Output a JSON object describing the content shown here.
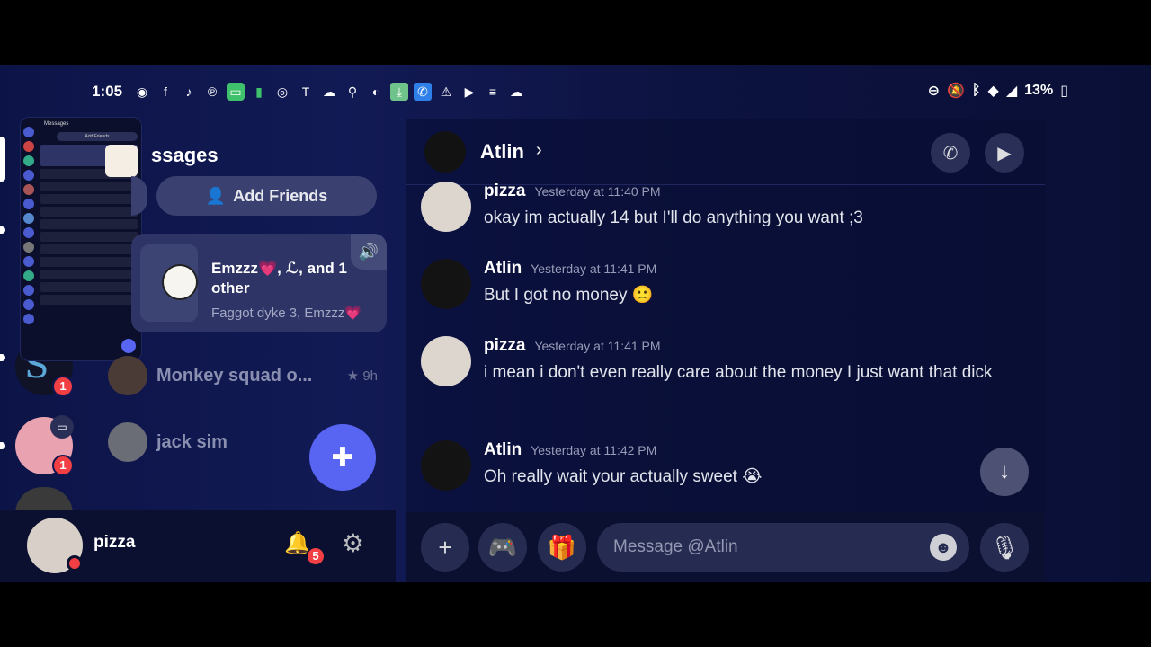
{
  "status_bar": {
    "time": "1:05",
    "battery": "13%",
    "left_icons": [
      "discord-icon",
      "facebook-icon",
      "tiktok-icon",
      "pinterest-icon",
      "messages-icon",
      "battery-small-icon",
      "instagram-icon",
      "t-icon",
      "soundcloud-icon",
      "keyhole-icon",
      "crunchyroll-icon",
      "download-icon",
      "phone-icon",
      "warning-icon",
      "youtube-icon",
      "menu-icon",
      "cloud-icon"
    ],
    "right_icons": [
      "dnd-icon",
      "bell-off-icon",
      "bluetooth-icon",
      "wifi-icon",
      "signal-icon",
      "battery-icon"
    ]
  },
  "dm_list": {
    "heading_partial": "ssages",
    "add_friends_label": "Add Friends",
    "group": {
      "name": "Emzzz💗, ℒ, and 1 other",
      "subtitle": "Faggot dyke 3, Emzzz💗"
    },
    "items": [
      {
        "name": "Monkey squad o...",
        "meta": "9h"
      },
      {
        "name": "jack sim",
        "meta": ""
      }
    ]
  },
  "server_rail": {
    "badges": [
      "1",
      "1"
    ]
  },
  "thumbnail": {
    "title": "Messages",
    "add_label": "Add Friends"
  },
  "user": {
    "name": "pizza",
    "notifications": "5"
  },
  "chat": {
    "recipient": "Atlin",
    "input_placeholder": "Message @Atlin",
    "messages": [
      {
        "author": "pizza",
        "time": "Yesterday at 11:40 PM",
        "text": "okay im actually 14 but I'll do anything you want ;3"
      },
      {
        "author": "Atlin",
        "time": "Yesterday at 11:41 PM",
        "text": "But I got no money 🙁"
      },
      {
        "author": "pizza",
        "time": "Yesterday at 11:41 PM",
        "text": "i mean i don't even really care about the money I just want that dick"
      },
      {
        "author": "Atlin",
        "time": "Yesterday at 11:42 PM",
        "text": "Oh really wait your actually sweet 😭"
      }
    ]
  },
  "colors": {
    "accent": "#5865f2",
    "badge": "#f23f43",
    "background": "#0c1447"
  }
}
